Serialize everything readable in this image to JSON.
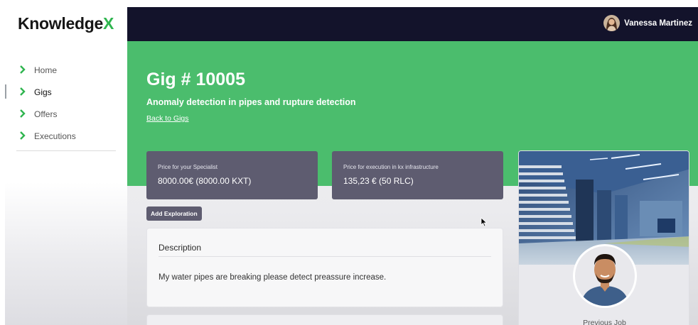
{
  "app": {
    "logo_text": "Knowledge",
    "logo_accent": "X",
    "brand_color": "#4bbd6d",
    "accent_color": "#2fb54f"
  },
  "sidebar": {
    "items": [
      {
        "label": "Home",
        "icon": "chevron-right-icon",
        "active": false
      },
      {
        "label": "Gigs",
        "icon": "chevron-right-icon",
        "active": true
      },
      {
        "label": "Offers",
        "icon": "chevron-right-icon",
        "active": false
      },
      {
        "label": "Executions",
        "icon": "chevron-right-icon",
        "active": false
      }
    ]
  },
  "header": {
    "user_name": "Vanessa Martinez",
    "background": "#13132b"
  },
  "gig": {
    "title": "Gig # 10005",
    "subtitle": "Anomaly detection in pipes and rupture detection",
    "back_link": "Back to Gigs"
  },
  "prices": [
    {
      "label": "Price for your Specialist",
      "value": "8000.00€ (8000.00 KXT)"
    },
    {
      "label": "Price for execution in kx infrastructure",
      "value": "135,23 € (50 RLC)"
    }
  ],
  "actions": {
    "add_exploration": "Add Exploration"
  },
  "description": {
    "heading": "Description",
    "text": "My water pipes are breaking please detect preassure increase."
  },
  "side_card": {
    "image": "warehouse-image",
    "avatar": "specialist-avatar",
    "caption": "Previous Job"
  }
}
